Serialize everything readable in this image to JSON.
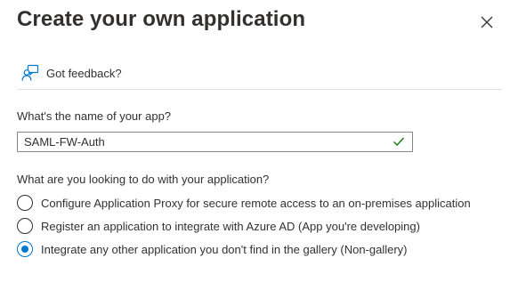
{
  "dialog": {
    "title": "Create your own application",
    "close_icon": "close-icon"
  },
  "feedback": {
    "icon": "feedback-person-icon",
    "label": "Got feedback?"
  },
  "app_name": {
    "label": "What's the name of your app?",
    "value": "SAML-FW-Auth",
    "valid_icon": "checkmark-icon",
    "valid_color": "#107c10"
  },
  "purpose": {
    "question": "What are you looking to do with your application?",
    "options": [
      {
        "label": "Configure Application Proxy for secure remote access to an on-premises application",
        "selected": false
      },
      {
        "label": "Register an application to integrate with Azure AD (App you're developing)",
        "selected": false
      },
      {
        "label": "Integrate any other application you don't find in the gallery (Non-gallery)",
        "selected": true
      }
    ]
  },
  "colors": {
    "accent": "#0078d4",
    "text": "#323130",
    "divider": "#e1dfdd"
  }
}
